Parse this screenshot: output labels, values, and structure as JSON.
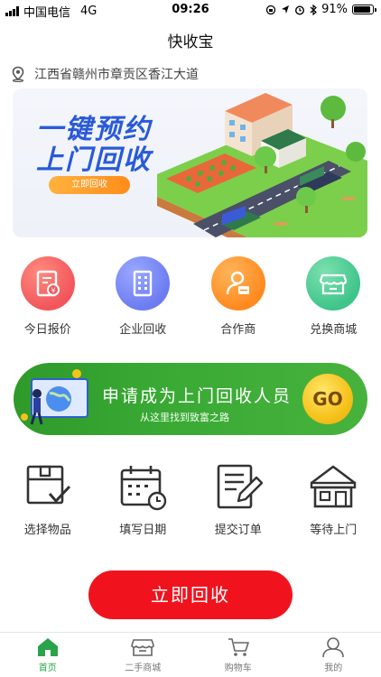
{
  "status_bar": {
    "carrier": "中国电信",
    "network": "4G",
    "time": "09:26",
    "battery": "91%",
    "battery_level": 0.91
  },
  "app": {
    "title": "快收宝"
  },
  "location": {
    "address": "江西省赣州市章贡区香江大道",
    "icon": "location-pin-icon"
  },
  "banner": {
    "line1": "一键预约",
    "line2": "上门回收",
    "button_label": "立即回收"
  },
  "categories": [
    {
      "label": "今日报价",
      "icon": "price-doc-icon",
      "color": "#f2565b"
    },
    {
      "label": "企业回收",
      "icon": "building-icon",
      "color": "#6c7cf0"
    },
    {
      "label": "合作商",
      "icon": "partner-icon",
      "color": "#ff8a1f"
    },
    {
      "label": "兑换商城",
      "icon": "shop-icon",
      "color": "#3fc48a"
    }
  ],
  "recruit": {
    "title": "申请成为上门回收人员",
    "subtitle": "从这里找到致富之路",
    "go_label": "GO"
  },
  "steps": [
    {
      "label": "选择物品",
      "icon": "box-check-icon"
    },
    {
      "label": "填写日期",
      "icon": "calendar-icon"
    },
    {
      "label": "提交订单",
      "icon": "order-edit-icon"
    },
    {
      "label": "等待上门",
      "icon": "house-icon"
    }
  ],
  "cta": {
    "label": "立即回收",
    "color": "#f0131d"
  },
  "tabbar": {
    "active_color": "#2aa34a",
    "items": [
      {
        "label": "首页",
        "icon": "home-icon",
        "active": true
      },
      {
        "label": "二手商城",
        "icon": "store-icon",
        "active": false
      },
      {
        "label": "购物车",
        "icon": "cart-icon",
        "active": false
      },
      {
        "label": "我的",
        "icon": "user-icon",
        "active": false
      }
    ]
  }
}
